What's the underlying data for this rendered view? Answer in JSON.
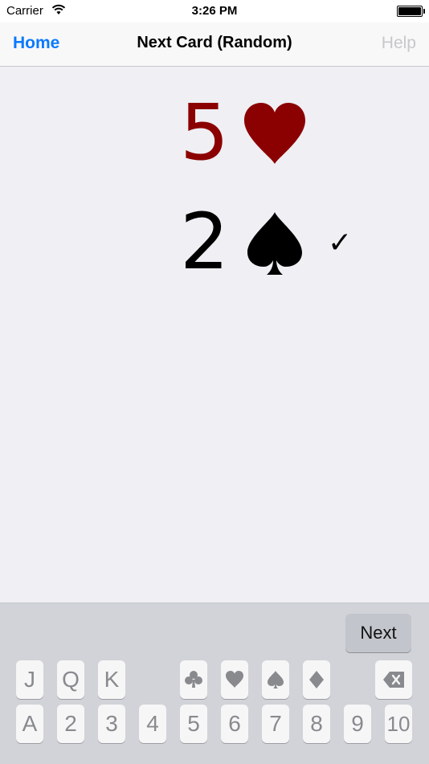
{
  "status_bar": {
    "carrier": "Carrier",
    "time": "3:26 PM"
  },
  "nav": {
    "back_label": "Home",
    "title": "Next Card (Random)",
    "help_label": "Help"
  },
  "cards": [
    {
      "rank": "5",
      "suit": "heart",
      "suit_icon": "heart-icon",
      "color": "#8b0000",
      "checked": false
    },
    {
      "rank": "2",
      "suit": "spade",
      "suit_icon": "spade-icon",
      "color": "#000000",
      "checked": true,
      "check_mark": "✓"
    }
  ],
  "keyboard": {
    "next_label": "Next",
    "face_keys": [
      "J",
      "Q",
      "K"
    ],
    "suit_keys": [
      "club-icon",
      "heart-icon",
      "spade-icon",
      "diamond-icon"
    ],
    "number_keys": [
      "A",
      "2",
      "3",
      "4",
      "5",
      "6",
      "7",
      "8",
      "9",
      "10"
    ],
    "backspace_icon": "backspace-icon"
  },
  "colors": {
    "accent": "#0a7aff",
    "disabled": "#c7c7cc",
    "heart_red": "#8b0000",
    "key_text": "#888a8e"
  }
}
